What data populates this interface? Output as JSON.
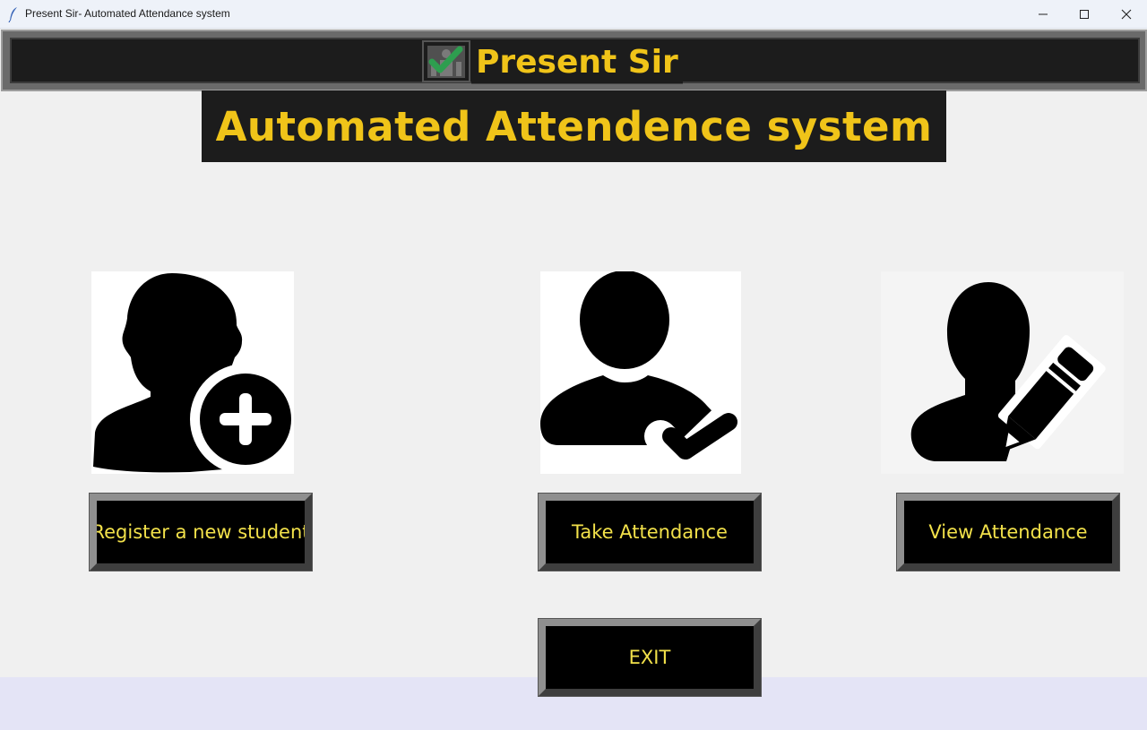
{
  "window": {
    "title": "Present Sir- Automated Attendance system"
  },
  "header": {
    "app_name": "Present Sir",
    "logo_icon": "attendance-check-logo-icon"
  },
  "subtitle": "Automated Attendence system",
  "tiles": {
    "register_icon": "user-add-icon",
    "take_icon": "user-check-icon",
    "view_icon": "user-edit-icon"
  },
  "buttons": {
    "register": "Register a new student",
    "take": "Take Attendance",
    "view": "View Attendance",
    "exit": "EXIT"
  },
  "colors": {
    "accent_text": "#f0c419",
    "button_text": "#f2e14a",
    "banner_bg": "#1c1c1c",
    "check_green": "#2e9e4f"
  }
}
